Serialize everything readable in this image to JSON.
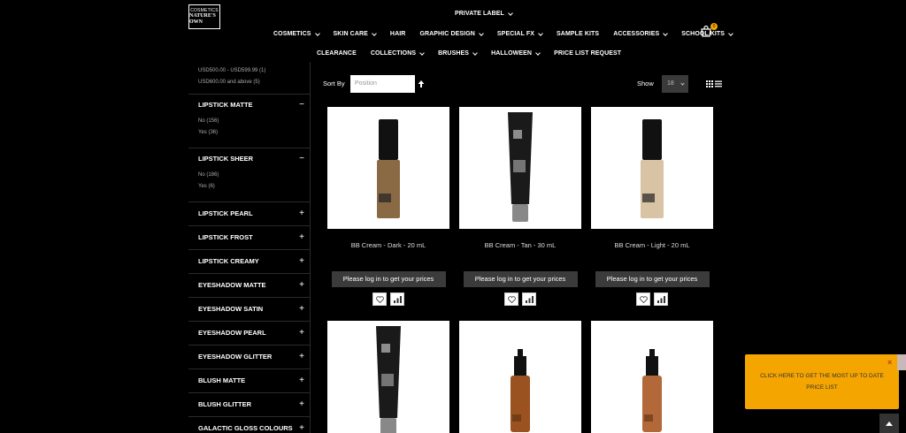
{
  "header": {
    "logo": {
      "top_text": "COSMETICS",
      "brand": "NATURE'S OWN"
    },
    "private_label": "PRIVATE LABEL",
    "nav_row1": [
      "COSMETICS",
      "SKIN CARE",
      "HAIR",
      "GRAPHIC DESIGN",
      "SPECIAL FX",
      "SAMPLE KITS",
      "ACCESSORIES",
      "SCHOOL KITS"
    ],
    "nav_row1_dropdown": [
      true,
      true,
      false,
      true,
      true,
      false,
      true,
      true
    ],
    "nav_row2": [
      "CLEARANCE",
      "COLLECTIONS",
      "BRUSHES",
      "HALLOWEEN",
      "PRICE LIST REQUEST"
    ],
    "nav_row2_dropdown": [
      false,
      true,
      true,
      true,
      false
    ],
    "cart_count": "0"
  },
  "sidebar": {
    "price_lines": [
      "USD500.00 - USD599.99 (1)",
      "USD600.00 and above (5)"
    ],
    "groups": [
      {
        "title": "LIPSTICK MATTE",
        "sign": "−",
        "options": [
          "No (156)",
          "Yes (36)"
        ]
      },
      {
        "title": "LIPSTICK SHEER",
        "sign": "−",
        "options": [
          "No (186)",
          "Yes (6)"
        ]
      },
      {
        "title": "LIPSTICK PEARL",
        "sign": "+"
      },
      {
        "title": "LIPSTICK FROST",
        "sign": "+"
      },
      {
        "title": "LIPSTICK CREAMY",
        "sign": "+"
      },
      {
        "title": "EYESHADOW MATTE",
        "sign": "+"
      },
      {
        "title": "EYESHADOW SATIN",
        "sign": "+"
      },
      {
        "title": "EYESHADOW PEARL",
        "sign": "+"
      },
      {
        "title": "EYESHADOW GLITTER",
        "sign": "+"
      },
      {
        "title": "BLUSH MATTE",
        "sign": "+"
      },
      {
        "title": "BLUSH GLITTER",
        "sign": "+"
      },
      {
        "title": "GALACTIC GLOSS COLOURS",
        "sign": "+"
      }
    ]
  },
  "toolbar": {
    "sort_label": "Sort By",
    "sort_value": "Position",
    "show_label": "Show",
    "show_value": "18"
  },
  "products": [
    {
      "name": "BB Cream - Dark - 20 mL",
      "price_button": "Please log in to get your prices",
      "shape": "bottle",
      "color": "#8a6a45"
    },
    {
      "name": "BB Cream - Tan - 30 mL",
      "price_button": "Please log in to get your prices",
      "shape": "tube",
      "color": "#1a1a1a"
    },
    {
      "name": "BB Cream - Light - 20 mL",
      "price_button": "Please log in to get your prices",
      "shape": "bottle",
      "color": "#d8c3a5"
    },
    {
      "name": "",
      "price_button": "",
      "shape": "tube",
      "color": "#1a1a1a"
    },
    {
      "name": "",
      "price_button": "",
      "shape": "dropper",
      "color": "#9a5220"
    },
    {
      "name": "",
      "price_button": "",
      "shape": "dropper",
      "color": "#b3683a"
    }
  ],
  "promo": {
    "text": "CLICK HERE TO GET THE MOST UP TO DATE PRICE LIST",
    "close": "×"
  },
  "colors": {
    "accent": "#f5a500",
    "background": "#000000",
    "button": "#3b3b3b"
  }
}
